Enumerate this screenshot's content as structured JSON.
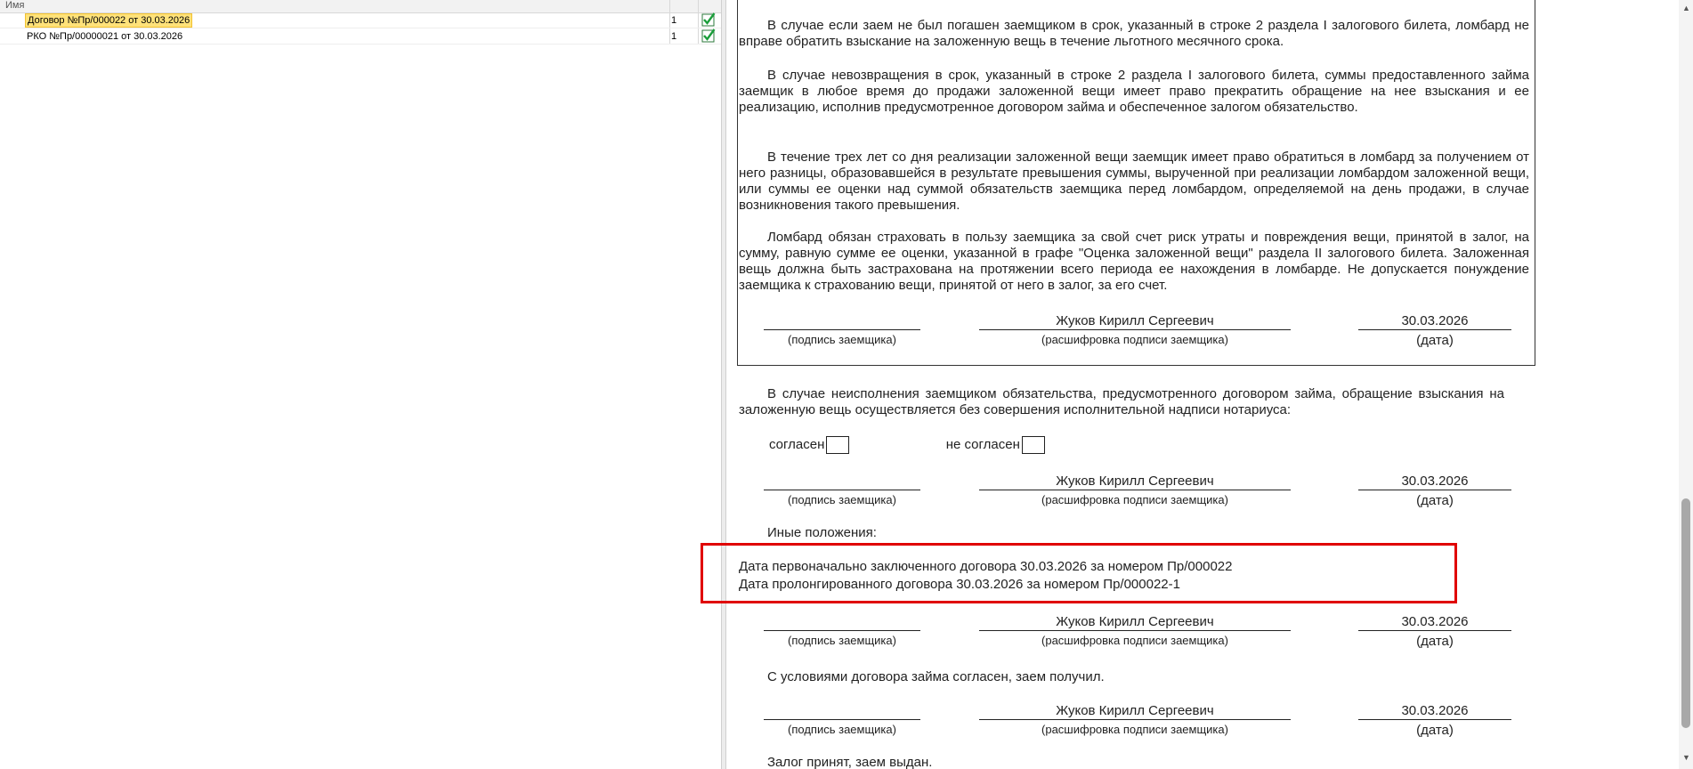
{
  "list": {
    "header": {
      "name_col": "Имя"
    },
    "rows": [
      {
        "name": "Договор №Пр/000022 от 30.03.2026",
        "count": "1",
        "checked": true
      },
      {
        "name": "РКО №Пр/00000021 от 30.03.2026",
        "count": "1",
        "checked": true
      }
    ]
  },
  "doc": {
    "p1": "В случае если заем не был погашен заемщиком в срок, указанный в строке 2 раздела I залогового билета, ломбард не вправе обратить взыскание на заложенную вещь в течение льготного месячного срока.",
    "p2": "В случае невозвращения в срок, указанный в строке 2 раздела I залогового билета, суммы предоставленного займа заемщик в любое время до продажи заложенной вещи имеет право прекратить обращение на нее взыскания и ее реализацию, исполнив предусмотренное договором займа и обеспеченное залогом обязательство.",
    "p3": "В течение трех лет со дня реализации заложенной вещи заемщик имеет право обратиться в ломбард за получением от него разницы, образовавшейся в результате превышения суммы, вырученной при реализации ломбардом заложенной вещи, или суммы ее оценки над суммой обязательств заемщика перед ломбардом, определяемой на день продажи, в случае возникновения такого превышения.",
    "p4": "Ломбард обязан страховать в пользу заемщика за свой счет риск утраты и повреждения вещи, принятой в залог, на сумму, равную сумме ее оценки, указанной в графе \"Оценка заложенной вещи\" раздела II залогового билета. Заложенная вещь должна быть застрахована на протяжении всего периода ее нахождения в ломбарде. Не допускается понуждение заемщика к страхованию вещи, принятой от него в залог, за его счет.",
    "p5": "В случае неисполнения заемщиком обязательства, предусмотренного договором займа, обращение взыскания на заложенную вещь осуществляется без совершения исполнительной надписи нотариуса:",
    "agree": "согласен",
    "disagree": "не согласен",
    "other_title": "Иные положения:",
    "other_line1": "Дата первоначально заключенного договора 30.03.2026 за номером Пр/000022",
    "other_line2": "Дата пролонгированного договора  30.03.2026 за номером Пр/000022-1",
    "conditions": "С условиями договора займа согласен, заем получил.",
    "pledge": "Залог принят, заем выдан.",
    "signature": {
      "name": "Жуков Кирилл Сергеевич",
      "date": "30.03.2026",
      "cap_sign": "(подпись заемщика)",
      "cap_decode": "(расшифровка подписи заемщика)",
      "cap_date": "(дата)"
    }
  },
  "colors": {
    "highlight": "#e00000",
    "selected_row": "#ffe27a",
    "check": "#1a9e3a"
  }
}
